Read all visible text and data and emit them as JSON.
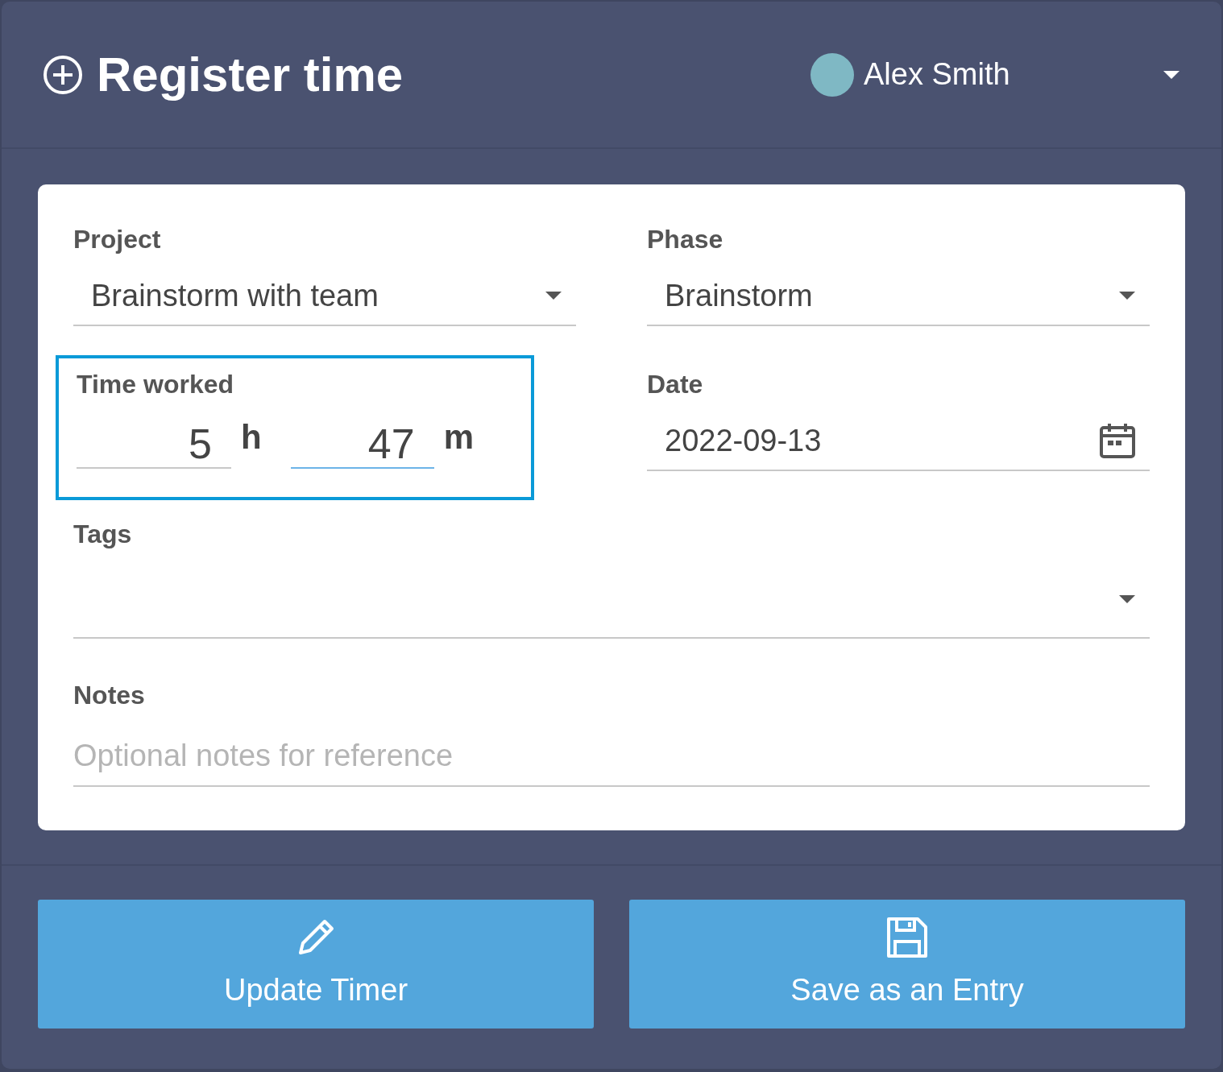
{
  "header": {
    "title": "Register time",
    "user": {
      "name": "Alex Smith"
    }
  },
  "form": {
    "project": {
      "label": "Project",
      "value": "Brainstorm with team"
    },
    "phase": {
      "label": "Phase",
      "value": "Brainstorm"
    },
    "time_worked": {
      "label": "Time worked",
      "highlighted": true,
      "hours": {
        "value": "5",
        "unit": "h",
        "focused": false
      },
      "minutes": {
        "value": "47",
        "unit": "m",
        "focused": true
      }
    },
    "date": {
      "label": "Date",
      "value": "2022-09-13"
    },
    "tags": {
      "label": "Tags"
    },
    "notes": {
      "label": "Notes",
      "placeholder": "Optional notes for reference"
    }
  },
  "buttons": [
    {
      "kind": "edit",
      "label": "Update Timer"
    },
    {
      "kind": "save",
      "label": "Save as an Entry"
    }
  ]
}
